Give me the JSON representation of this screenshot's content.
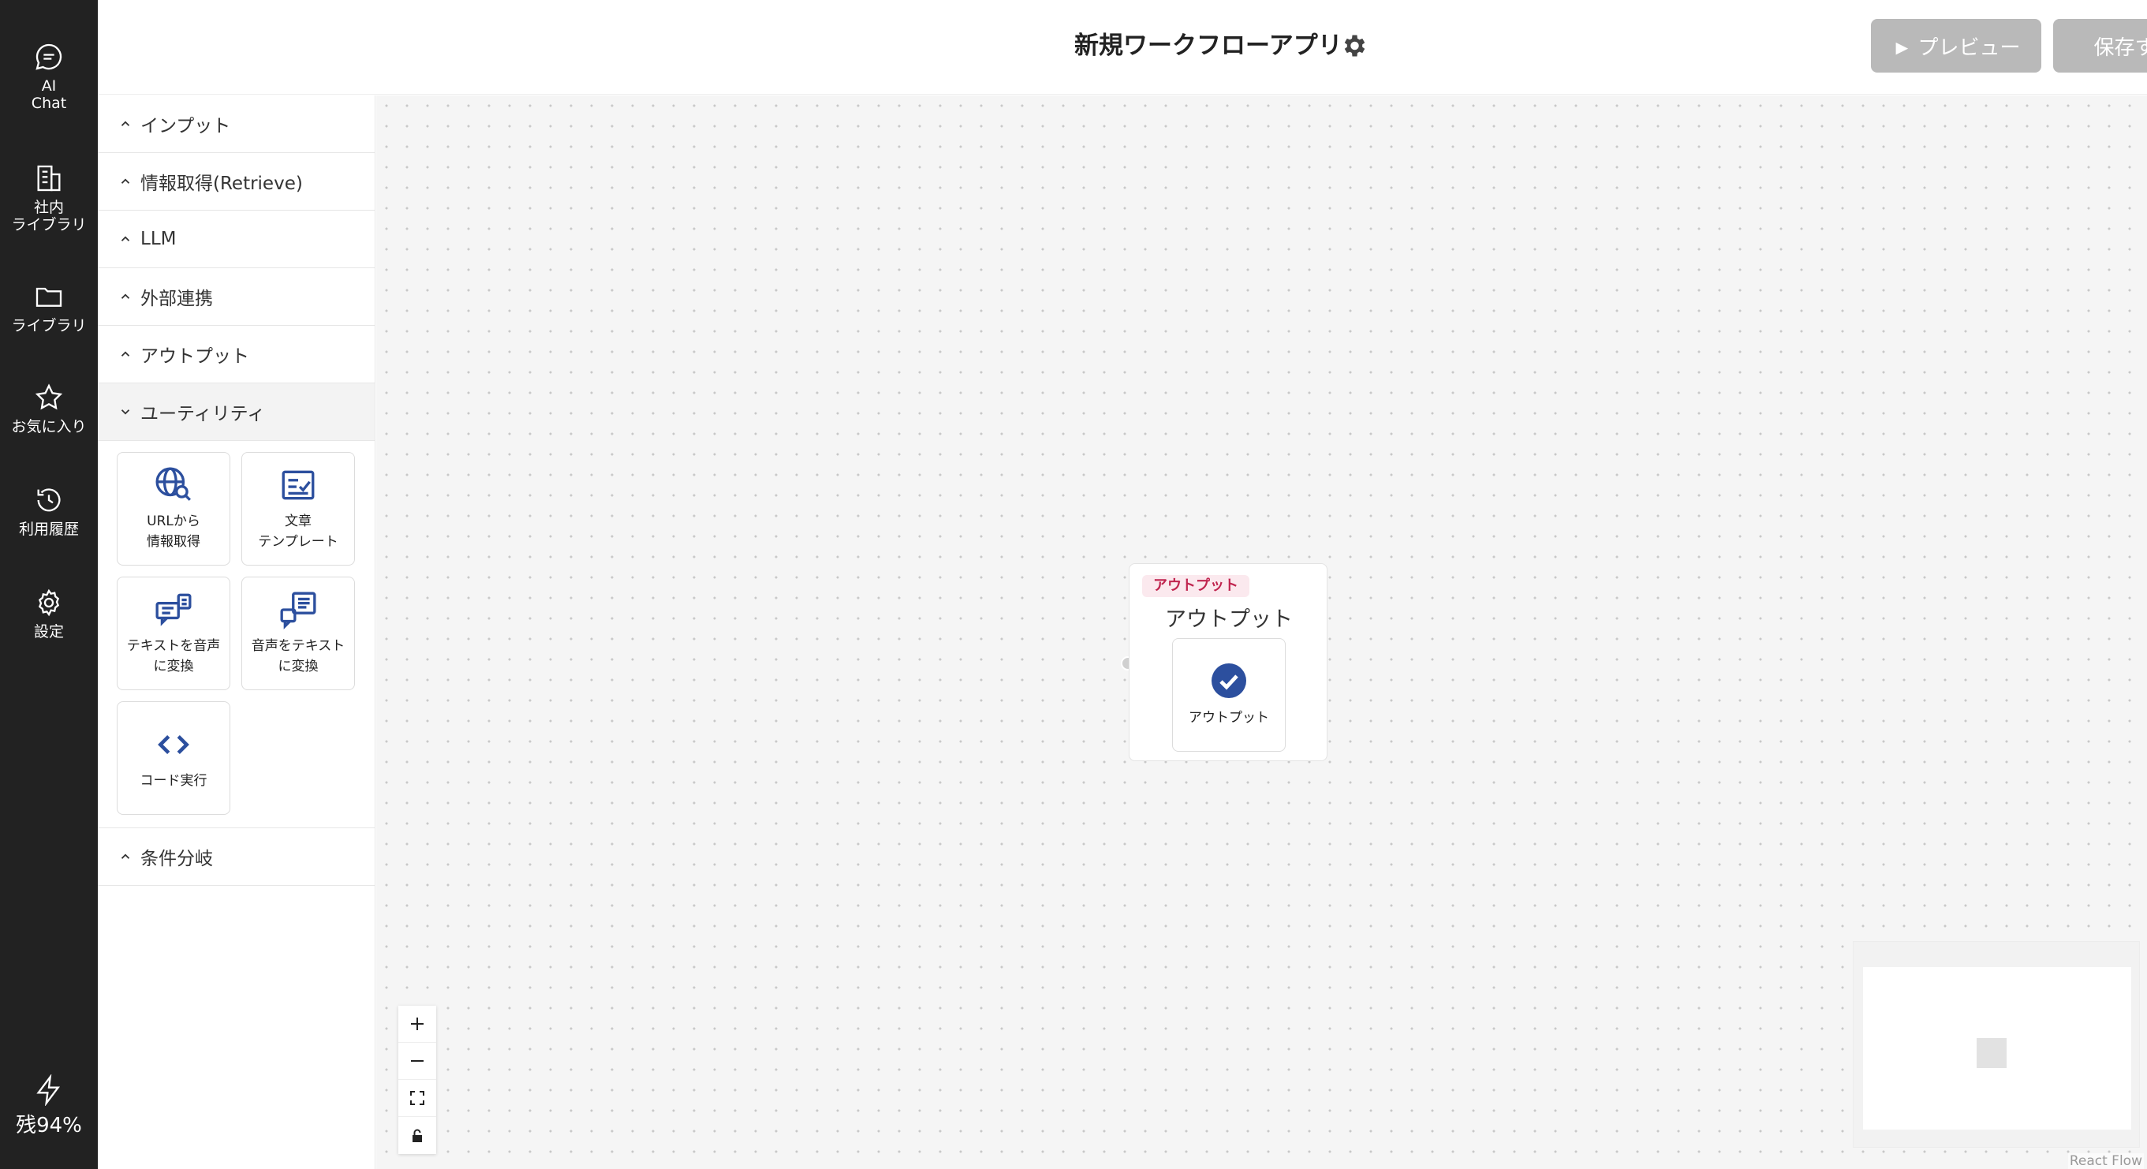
{
  "rail": {
    "items": [
      {
        "label": "AI\nChat",
        "icon": "chat-bubble-icon"
      },
      {
        "label": "社内\nライブラリ",
        "icon": "building-icon"
      },
      {
        "label": "ライブラリ",
        "icon": "folder-icon"
      },
      {
        "label": "お気に入り",
        "icon": "star-icon"
      },
      {
        "label": "利用履歴",
        "icon": "history-icon"
      },
      {
        "label": "設定",
        "icon": "gear-icon"
      }
    ],
    "quota": "残94%"
  },
  "header": {
    "title": "新規ワークフローアプリ",
    "preview_label": "► プレビュー",
    "save_label": "保存する"
  },
  "palette": {
    "categories": [
      {
        "label": "インプット",
        "expanded": false
      },
      {
        "label": "情報取得(Retrieve)",
        "expanded": false
      },
      {
        "label": "LLM",
        "expanded": false
      },
      {
        "label": "外部連携",
        "expanded": false
      },
      {
        "label": "アウトプット",
        "expanded": false
      },
      {
        "label": "ユーティリティ",
        "expanded": true
      },
      {
        "label": "条件分岐",
        "expanded": false
      }
    ],
    "utility_tiles": [
      {
        "label": "URLから\n情報取得",
        "icon": "globe-search-icon"
      },
      {
        "label": "文章\nテンプレート",
        "icon": "document-check-icon"
      },
      {
        "label": "テキストを音声\nに変換",
        "icon": "text-to-speech-icon"
      },
      {
        "label": "音声をテキスト\nに変換",
        "icon": "speech-to-text-icon"
      },
      {
        "label": "コード実行",
        "icon": "code-icon"
      }
    ]
  },
  "canvas": {
    "node": {
      "badge": "アウトプット",
      "title": "アウトプット",
      "item_label": "アウトプット"
    },
    "attribution": "React Flow"
  },
  "colors": {
    "rail_bg": "#222222",
    "accent_blue": "#2c4f9e",
    "badge_bg": "#fbe9ee",
    "badge_text": "#c0254f",
    "button_disabled": "#b9b9b9"
  }
}
